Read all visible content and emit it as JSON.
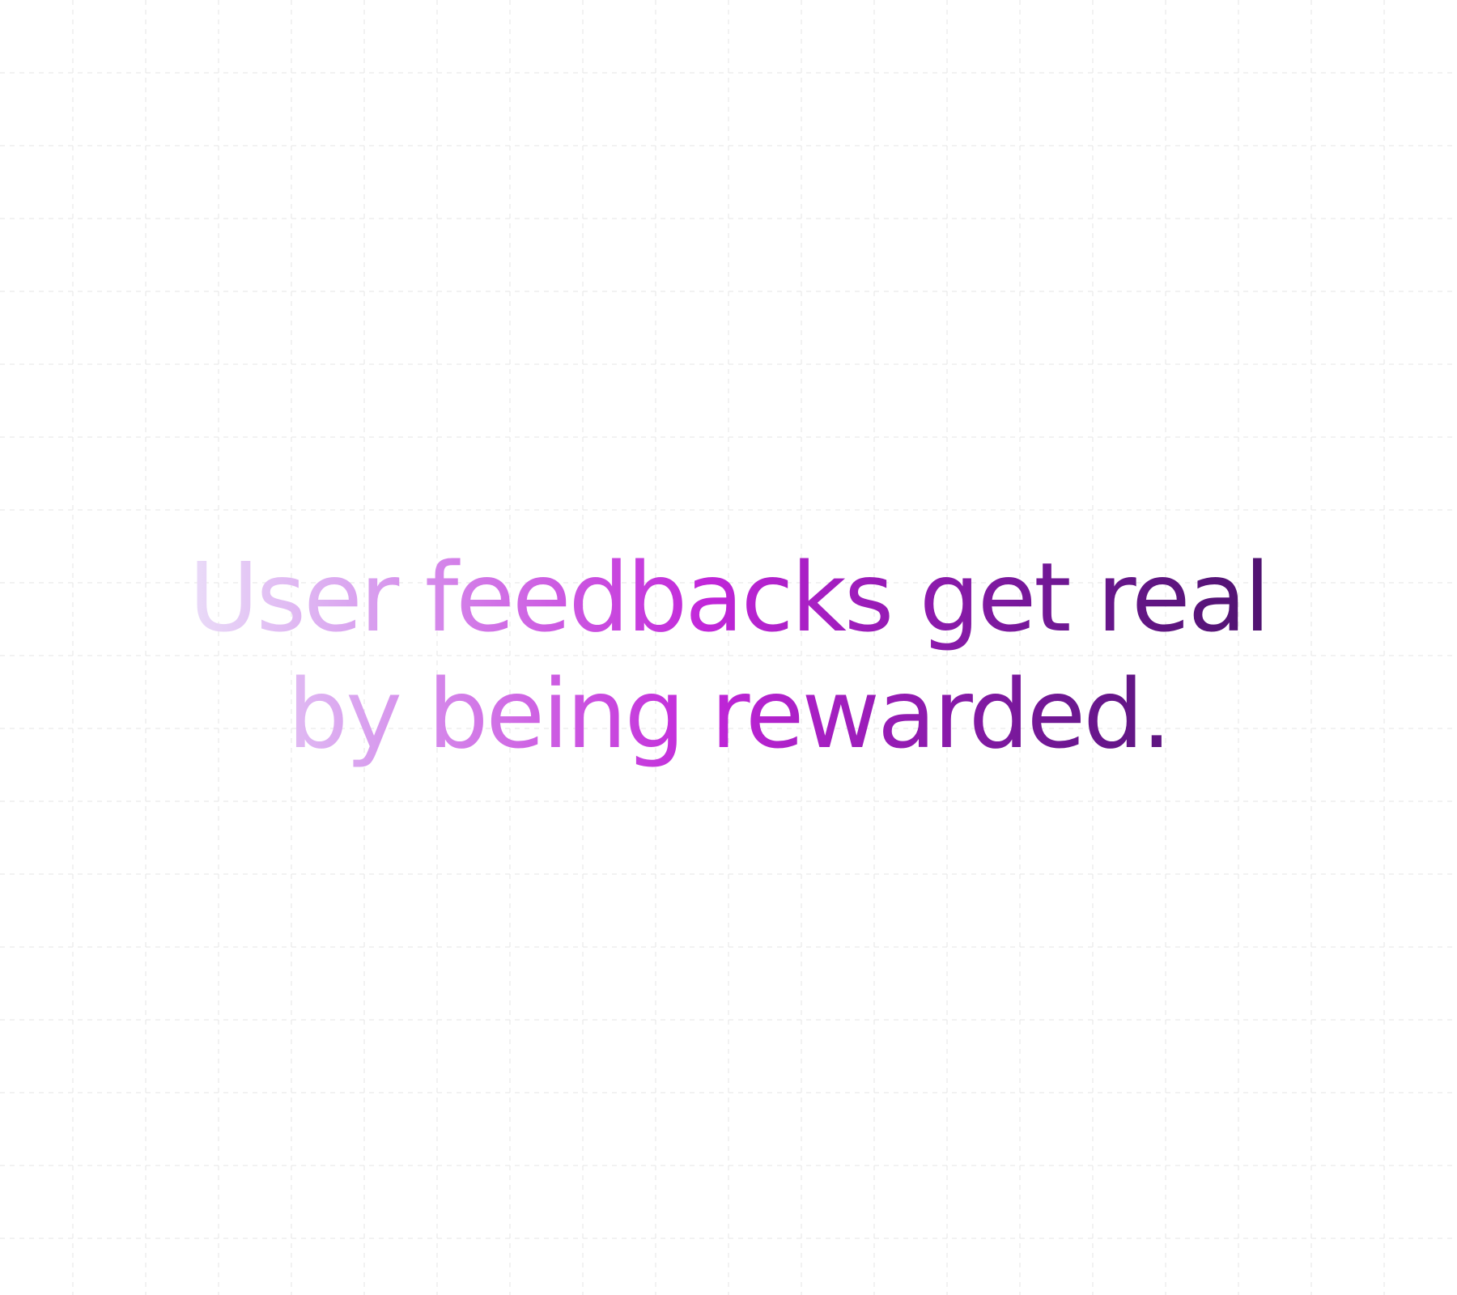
{
  "headline": {
    "line1": "User feedbacks get real",
    "line2": "by being rewarded."
  },
  "colors": {
    "background": "#ffffff",
    "grid_line": "#e6e6e6",
    "gradient_start": "#eadcf8",
    "gradient_mid": "#c126d9",
    "gradient_end": "#4f136f"
  }
}
